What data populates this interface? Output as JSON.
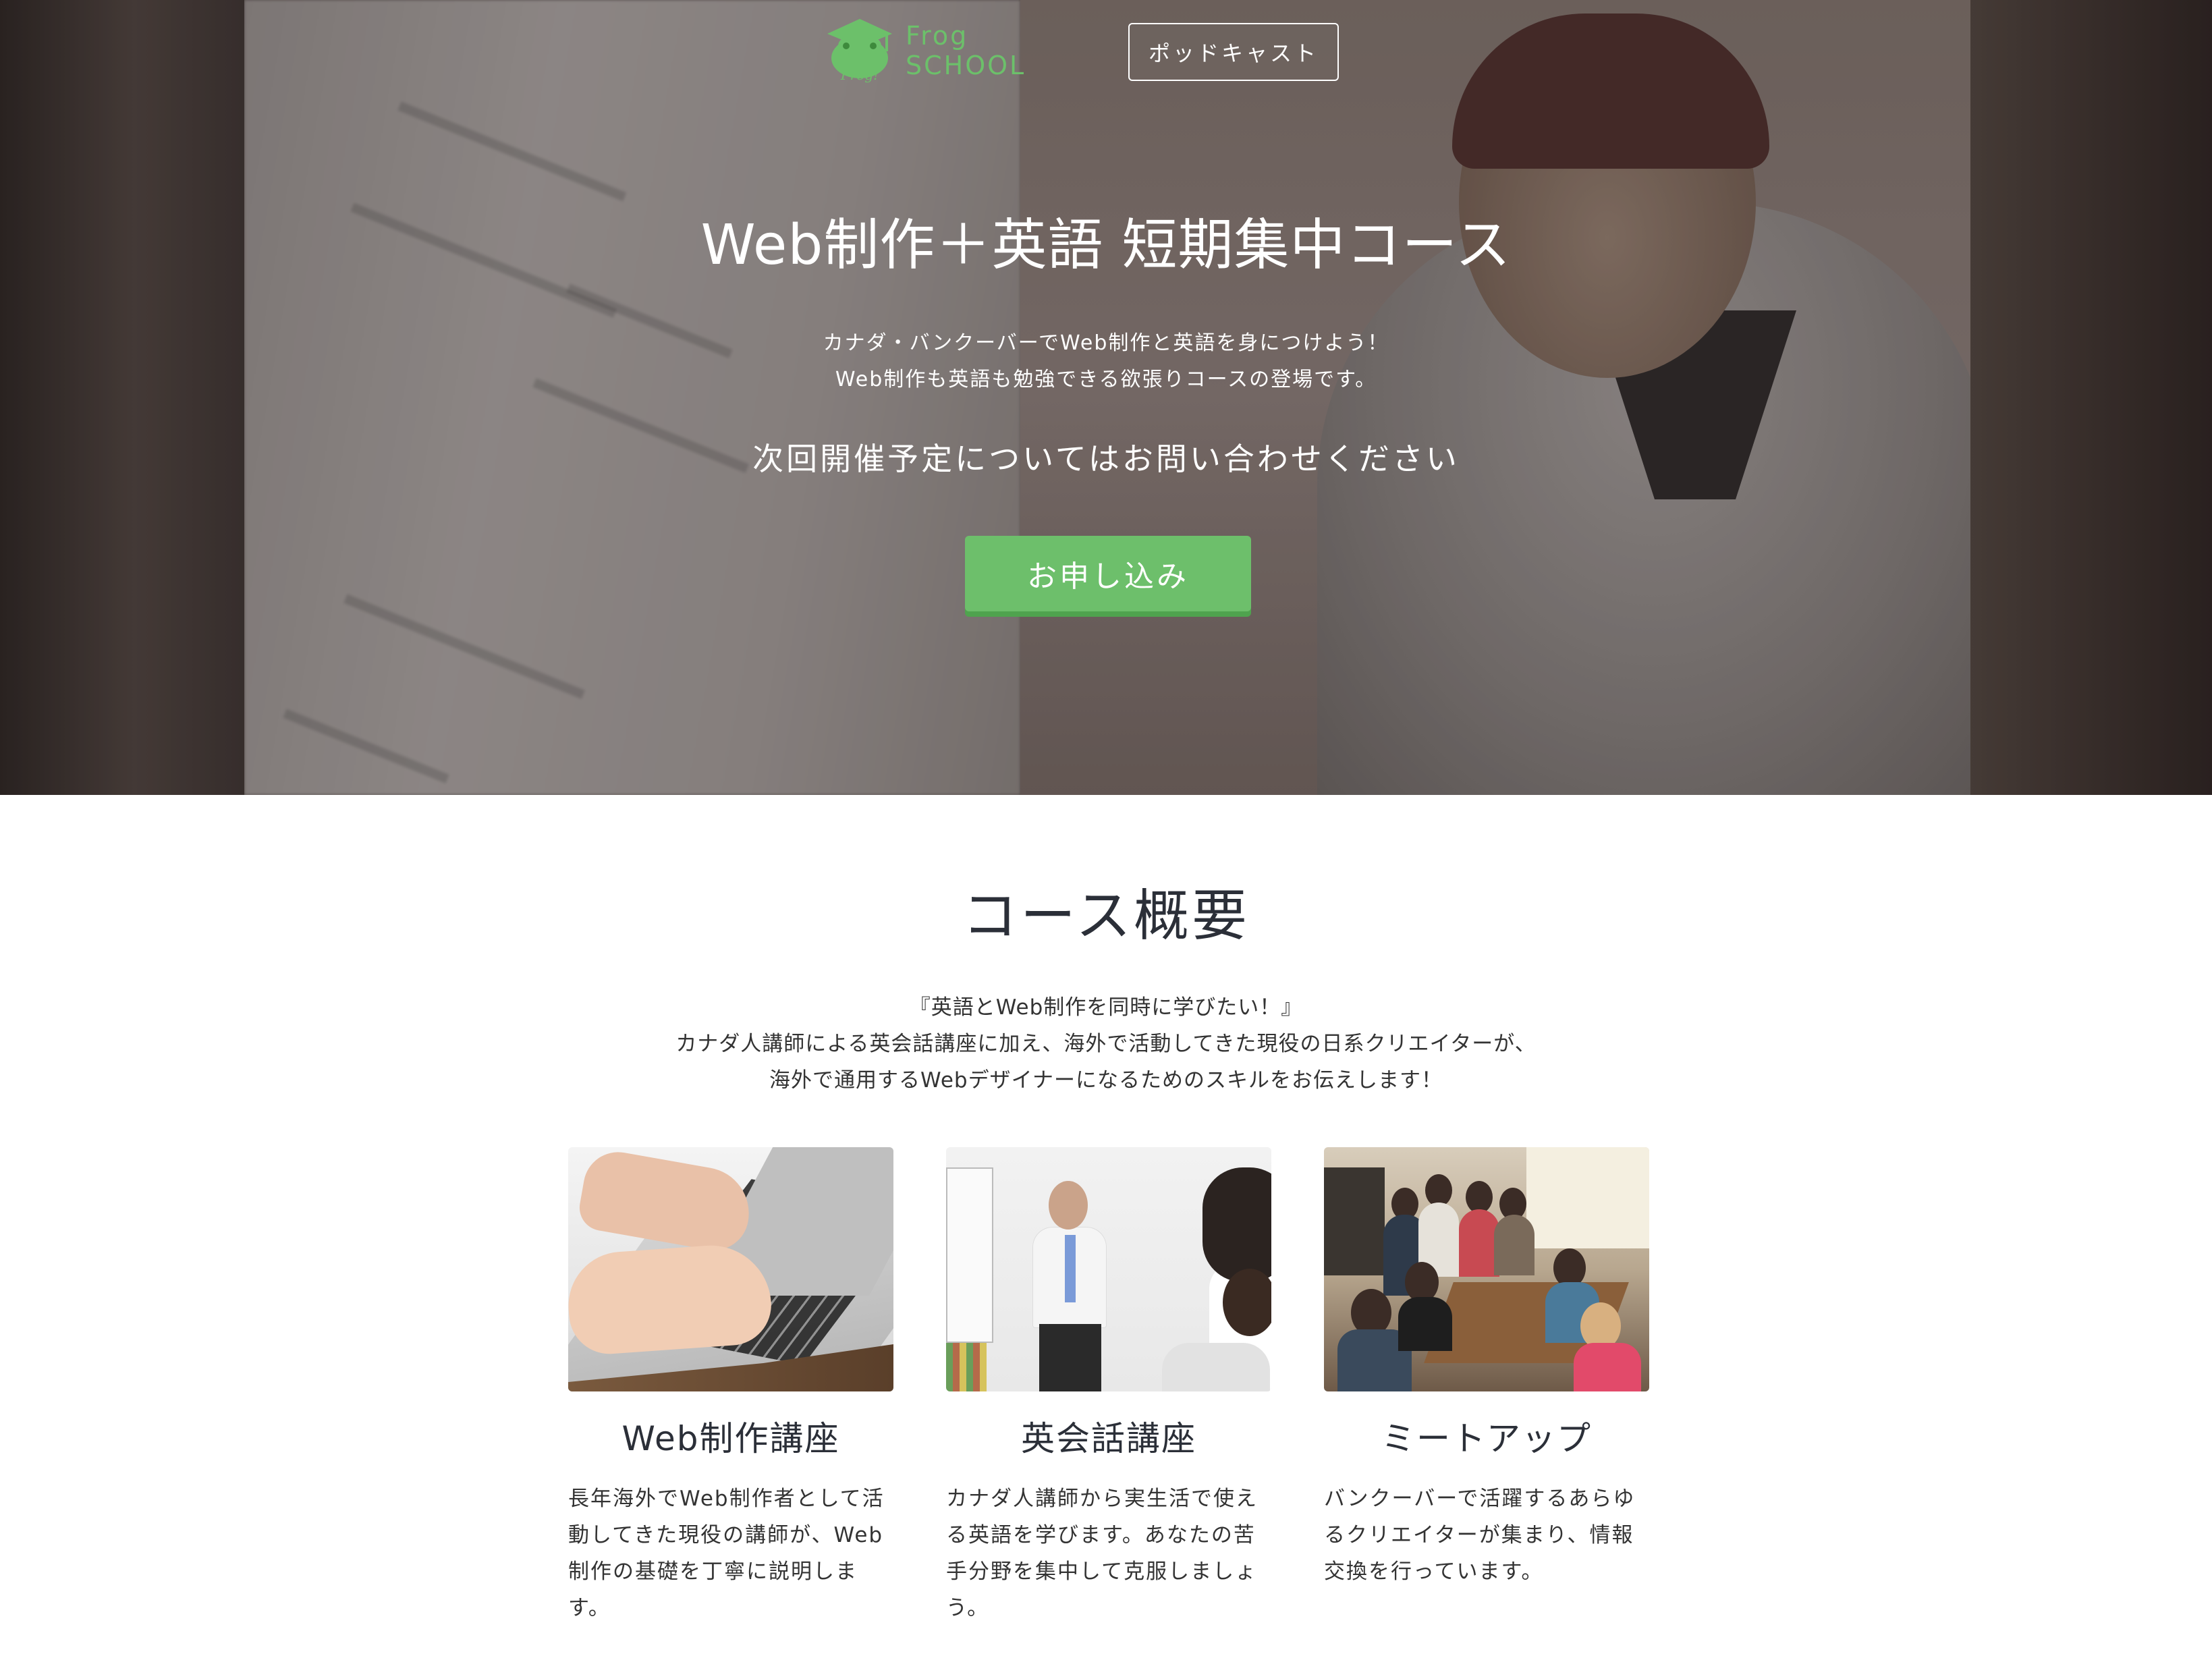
{
  "header": {
    "logo_text": "Frog SCHOOL",
    "logo_mark_text": "Frog!",
    "podcast_label": "ポッドキャスト"
  },
  "hero": {
    "title": "Web制作＋英語 短期集中コース",
    "subtitle_lines": [
      "カナダ・バンクーバーでWeb制作と英語を身につけよう！",
      "Web制作も英語も勉強できる欲張りコースの登場です。"
    ],
    "next_session": "次回開催予定についてはお問い合わせください",
    "apply_label": "お申し込み"
  },
  "overview": {
    "title": "コース概要",
    "desc_lines": [
      "『英語とWeb制作を同時に学びたい！』",
      "カナダ人講師による英会話講座に加え、海外で活動してきた現役の日系クリエイターが、",
      "海外で通用するWebデザイナーになるためのスキルをお伝えします！"
    ],
    "cards": [
      {
        "title": "Web制作講座",
        "text": "長年海外でWeb制作者として活動してきた現役の講師が、Web制作の基礎を丁寧に説明します。"
      },
      {
        "title": "英会話講座",
        "text": "カナダ人講師から実生活で使える英語を学びます。あなたの苦手分野を集中して克服しましょう。"
      },
      {
        "title": "ミートアップ",
        "text": "バンクーバーで活躍するあらゆるクリエイターが集まり、情報交換を行っています。"
      }
    ]
  },
  "colors": {
    "brand_green": "#6dbf6b",
    "logo_green": "#6cc06a",
    "heading_dark": "#2b2f38"
  },
  "icons": {
    "logo": "frog-graduation-cap-icon"
  }
}
